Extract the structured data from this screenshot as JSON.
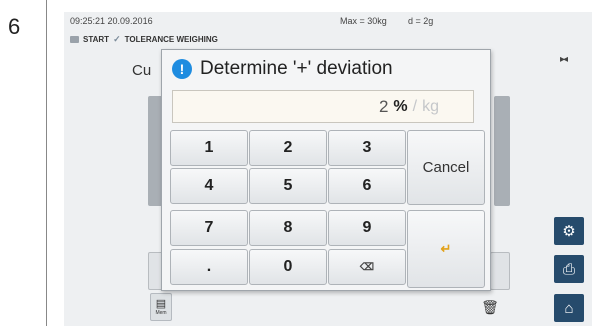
{
  "step": {
    "number": "6"
  },
  "status": {
    "time": "09:25:21 20.09.2016",
    "max": "Max = 30kg",
    "d": "d = 2g"
  },
  "breadcrumb": {
    "start": "START",
    "separator": "✓",
    "current": "TOLERANCE WEIGHING"
  },
  "background": {
    "title_fragment": "Cu"
  },
  "footer": {
    "mem_label": "Mem"
  },
  "dialog": {
    "title": "Determine '+' deviation",
    "input_value": "2",
    "unit_selected": "%",
    "unit_separator": "/",
    "unit_alternative": "kg"
  },
  "keypad": {
    "k1": "1",
    "k2": "2",
    "k3": "3",
    "k4": "4",
    "k5": "5",
    "k6": "6",
    "k7": "7",
    "k8": "8",
    "k9": "9",
    "kdot": ".",
    "k0": "0",
    "cancel": "Cancel"
  },
  "icons": {
    "info": "info-icon",
    "backspace": "backspace-icon",
    "enter": "enter-icon",
    "settings": "gear-icon",
    "print": "printer-icon",
    "home": "home-icon",
    "delete": "trash-icon",
    "memory": "memory-icon"
  },
  "colors": {
    "info_blue": "#1e8ce0",
    "sidebar_navy": "#264b6c",
    "enter_orange": "#e2a21a"
  }
}
